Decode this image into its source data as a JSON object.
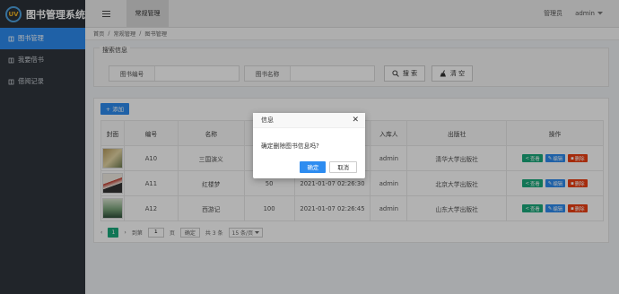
{
  "app": {
    "title": "图书管理系统",
    "logo_text": "UV"
  },
  "sidebar": {
    "items": [
      {
        "label": "图书管理",
        "active": true
      },
      {
        "label": "我要借书",
        "active": false
      },
      {
        "label": "借阅记录",
        "active": false
      }
    ]
  },
  "topbar": {
    "active_tab": "常规管理",
    "role": "管理员",
    "user": "admin"
  },
  "breadcrumb": {
    "home": "首页",
    "section": "常规管理",
    "page": "图书管理",
    "sep": "/"
  },
  "search": {
    "legend": "搜索信息",
    "field1_label": "图书编号",
    "field2_label": "图书名称",
    "search_button": "搜 索",
    "clear_button": "清 空"
  },
  "table": {
    "add_button": "添加",
    "columns": [
      "封面",
      "编号",
      "名称",
      "",
      "",
      "入库人",
      "出版社",
      "操作"
    ],
    "rows": [
      {
        "id": "A10",
        "name": "三国演义",
        "count": "",
        "time": "",
        "by": "admin",
        "publisher": "清华大学出版社"
      },
      {
        "id": "A11",
        "name": "红楼梦",
        "count": "50",
        "time": "2021-01-07 02:26:30",
        "by": "admin",
        "publisher": "北京大学出版社"
      },
      {
        "id": "A12",
        "name": "西游记",
        "count": "100",
        "time": "2021-01-07 02:26:45",
        "by": "admin",
        "publisher": "山东大学出版社"
      }
    ],
    "ops": {
      "view": "查看",
      "edit": "编辑",
      "delete": "删除"
    }
  },
  "pager": {
    "current": "1",
    "goto_prefix": "到第",
    "goto_value": "1",
    "goto_suffix": "页",
    "confirm": "确定",
    "total": "共 3 条",
    "size": "15 条/页"
  },
  "modal": {
    "title": "信息",
    "message": "确定删除图书信息吗?",
    "ok": "确定",
    "cancel": "取消"
  },
  "colors": {
    "accent": "#2d8cf0",
    "sidebar": "#30363d",
    "view": "#19a97b",
    "delete": "#ed4014"
  }
}
